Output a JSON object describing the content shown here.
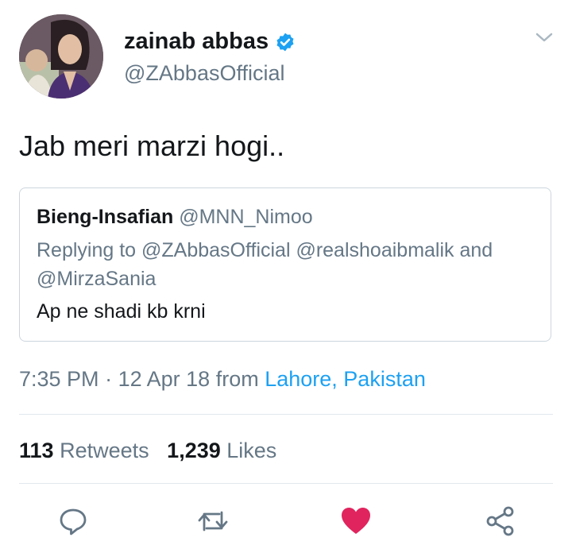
{
  "author": {
    "display_name": "zainab abbas",
    "handle": "@ZAbbasOfficial",
    "verified": true
  },
  "tweet": {
    "text": "Jab meri marzi hogi.."
  },
  "quoted_tweet": {
    "author_name": "Bieng-Insafian",
    "author_handle": "@MNN_Nimoo",
    "reply_line": "Replying to @ZAbbasOfficial @realshoaibmalik and @MirzaSania",
    "text": "Ap ne shadi kb krni"
  },
  "meta": {
    "time": "7:35 PM",
    "separator": "·",
    "date": "12 Apr 18",
    "from_label": "from",
    "location": "Lahore, Pakistan"
  },
  "stats": {
    "retweets_count": "113",
    "retweets_label": "Retweets",
    "likes_count": "1,239",
    "likes_label": "Likes"
  },
  "colors": {
    "link_blue": "#1da1f2",
    "like_red": "#e0245e",
    "secondary_gray": "#657786"
  },
  "icons": {
    "more": "chevron-down-icon",
    "verified": "verified-badge-icon",
    "reply": "reply-icon",
    "retweet": "retweet-icon",
    "like": "heart-icon",
    "share": "share-icon"
  }
}
